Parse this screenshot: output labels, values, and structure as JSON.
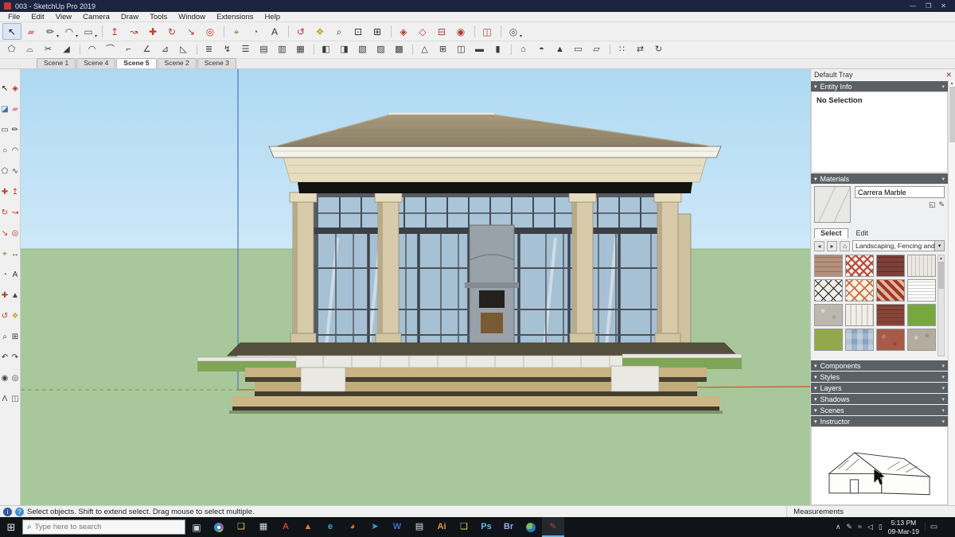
{
  "window": {
    "title": "003 - SketchUp Pro 2019",
    "controls": {
      "minimize": "—",
      "maximize": "❐",
      "close": "✕"
    }
  },
  "menu_bar": {
    "items": [
      {
        "name": "menu-file",
        "label": "File"
      },
      {
        "name": "menu-edit",
        "label": "Edit"
      },
      {
        "name": "menu-view",
        "label": "View"
      },
      {
        "name": "menu-camera",
        "label": "Camera"
      },
      {
        "name": "menu-draw",
        "label": "Draw"
      },
      {
        "name": "menu-tools",
        "label": "Tools"
      },
      {
        "name": "menu-window",
        "label": "Window"
      },
      {
        "name": "menu-extensions",
        "label": "Extensions"
      },
      {
        "name": "menu-help",
        "label": "Help"
      }
    ]
  },
  "toolbar_main": {
    "icons": [
      {
        "name": "select-tool",
        "g": "↖",
        "color": "#111111",
        "active": true
      },
      {
        "name": "eraser-tool",
        "g": "▰",
        "color": "#de8da4"
      },
      {
        "name": "line-tool",
        "g": "✏",
        "color": "#333333",
        "caret": true
      },
      {
        "name": "arc-tool",
        "g": "◠",
        "color": "#7a3636",
        "caret": true
      },
      {
        "name": "rectangle-tool",
        "g": "▭",
        "color": "#555555",
        "caret": true
      },
      {
        "name": "pushpull-tool",
        "g": "↥",
        "color": "#c0392b",
        "sep": true
      },
      {
        "name": "followme-tool",
        "g": "↝",
        "color": "#c0392b"
      },
      {
        "name": "move-tool",
        "g": "✚",
        "color": "#c0392b"
      },
      {
        "name": "rotate-tool",
        "g": "↻",
        "color": "#c0392b"
      },
      {
        "name": "scale-tool",
        "g": "↘",
        "color": "#c0392b"
      },
      {
        "name": "offset-tool",
        "g": "◎",
        "color": "#c0392b"
      },
      {
        "name": "tape-measure-tool",
        "g": "⌖",
        "color": "#8a6d1f",
        "sep": true
      },
      {
        "name": "protractor-tool",
        "g": "◔",
        "color": "#8a6d1f"
      },
      {
        "name": "text-tool",
        "g": "A",
        "color": "#333333"
      },
      {
        "name": "orbit-tool",
        "g": "↺",
        "color": "#b03a2e",
        "sep": true
      },
      {
        "name": "pan-tool",
        "g": "❖",
        "color": "#cf9f35"
      },
      {
        "name": "zoom-tool",
        "g": "⌕",
        "color": "#333333"
      },
      {
        "name": "zoom-window-tool",
        "g": "⊡",
        "color": "#333333"
      },
      {
        "name": "zoom-extents-tool",
        "g": "⊞",
        "color": "#333333"
      },
      {
        "name": "make-component-tool",
        "g": "◈",
        "color": "#b03a2e",
        "sep": true
      },
      {
        "name": "component-options-tool",
        "g": "◇",
        "color": "#b03a2e"
      },
      {
        "name": "dynamic-component-tool",
        "g": "⊟",
        "color": "#b03a2e"
      },
      {
        "name": "interact-tool",
        "g": "◉",
        "color": "#b03a2e"
      },
      {
        "name": "section-plane-tool",
        "g": "◫",
        "color": "#b03a2e",
        "sep": true
      },
      {
        "name": "look-around-tool",
        "g": "◎",
        "color": "#555555",
        "caret": true,
        "sep": true
      }
    ]
  },
  "toolbar_secondary": {
    "icons": [
      {
        "name": "offset-edges-tool",
        "g": "⬠"
      },
      {
        "name": "extrude-profile-tool",
        "g": "⌓"
      },
      {
        "name": "cut-opening-tool",
        "g": "✂"
      },
      {
        "name": "taper-face-tool",
        "g": "◢"
      },
      {
        "name": "arc-wall-tool",
        "g": "◠",
        "sep": true
      },
      {
        "name": "fillet-edge-tool",
        "g": "⌒"
      },
      {
        "name": "corner-trim-tool",
        "g": "⌐"
      },
      {
        "name": "chamfer-tool",
        "g": "∠"
      },
      {
        "name": "slope-face-tool",
        "g": "⊿"
      },
      {
        "name": "ramp-tool",
        "g": "◺"
      },
      {
        "name": "stairs-tool",
        "g": "≣",
        "sep": true
      },
      {
        "name": "spiral-stairs-tool",
        "g": "↯"
      },
      {
        "name": "railing-tool",
        "g": "☰"
      },
      {
        "name": "fence-tool",
        "g": "▤"
      },
      {
        "name": "louver-tool",
        "g": "▥"
      },
      {
        "name": "lattice-tool",
        "g": "▦"
      },
      {
        "name": "shade-left-tool",
        "g": "◧",
        "sep": true
      },
      {
        "name": "shade-right-tool",
        "g": "◨"
      },
      {
        "name": "hatch-one-tool",
        "g": "▧"
      },
      {
        "name": "hatch-two-tool",
        "g": "▨"
      },
      {
        "name": "grille-tool",
        "g": "▩"
      },
      {
        "name": "truss-tool",
        "g": "△",
        "sep": true
      },
      {
        "name": "frame-tool",
        "g": "⊞"
      },
      {
        "name": "panel-tool",
        "g": "◫"
      },
      {
        "name": "beam-tool",
        "g": "▬"
      },
      {
        "name": "column-tool",
        "g": "▮"
      },
      {
        "name": "roof-tool",
        "g": "⌂",
        "sep": true
      },
      {
        "name": "dome-tool",
        "g": "◓"
      },
      {
        "name": "pyramid-tool",
        "g": "▲"
      },
      {
        "name": "wall-tool",
        "g": "▭"
      },
      {
        "name": "floor-tool",
        "g": "▱"
      },
      {
        "name": "array-tool",
        "g": "∷",
        "sep": true
      },
      {
        "name": "mirror-tool",
        "g": "⇄"
      },
      {
        "name": "rotate-array-tool",
        "g": "↻"
      }
    ]
  },
  "scene_tabs": {
    "tabs": [
      {
        "name": "scene-tab-1",
        "label": "Scene 1"
      },
      {
        "name": "scene-tab-4",
        "label": "Scene 4"
      },
      {
        "name": "scene-tab-5",
        "label": "Scene 5",
        "active": true
      },
      {
        "name": "scene-tab-2",
        "label": "Scene 2"
      },
      {
        "name": "scene-tab-3",
        "label": "Scene 3"
      }
    ]
  },
  "left_toolbar": {
    "icons": [
      {
        "name": "select-tool",
        "g": "↖",
        "color": "#111111"
      },
      {
        "name": "make-component-tool",
        "g": "◈",
        "color": "#b03a2e"
      },
      {
        "name": "paint-bucket-tool",
        "g": "◪",
        "color": "#3f6db5"
      },
      {
        "name": "eraser-tool",
        "g": "▰",
        "color": "#de8da4"
      },
      {
        "name": "rectangle-tool",
        "g": "▭",
        "color": "#444444"
      },
      {
        "name": "line-tool",
        "g": "✏",
        "color": "#333333"
      },
      {
        "name": "circle-tool",
        "g": "○",
        "color": "#444444"
      },
      {
        "name": "arc-tool",
        "g": "◠",
        "color": "#444444"
      },
      {
        "name": "polygon-tool",
        "g": "⬠",
        "color": "#444444"
      },
      {
        "name": "freehand-tool",
        "g": "∿",
        "color": "#444444"
      },
      {
        "name": "move-tool",
        "g": "✚",
        "color": "#c0392b"
      },
      {
        "name": "pushpull-tool",
        "g": "↥",
        "color": "#c0392b"
      },
      {
        "name": "rotate-tool",
        "g": "↻",
        "color": "#c0392b"
      },
      {
        "name": "followme-tool",
        "g": "↝",
        "color": "#c0392b"
      },
      {
        "name": "scale-tool",
        "g": "↘",
        "color": "#c0392b"
      },
      {
        "name": "offset-tool",
        "g": "◎",
        "color": "#c0392b"
      },
      {
        "name": "tape-measure-tool",
        "g": "⌖",
        "color": "#8a6d1f"
      },
      {
        "name": "dimension-tool",
        "g": "↔",
        "color": "#333333"
      },
      {
        "name": "protractor-tool",
        "g": "◔",
        "color": "#8a6d1f"
      },
      {
        "name": "text-tool",
        "g": "A",
        "color": "#333333"
      },
      {
        "name": "axes-tool",
        "g": "✚",
        "color": "#b03a2e"
      },
      {
        "name": "threed-text-tool",
        "g": "▲",
        "color": "#444444"
      },
      {
        "name": "orbit-tool",
        "g": "↺",
        "color": "#b03a2e"
      },
      {
        "name": "pan-tool",
        "g": "❖",
        "color": "#cf9f35"
      },
      {
        "name": "zoom-tool",
        "g": "⌕",
        "color": "#333333"
      },
      {
        "name": "zoom-extents-tool",
        "g": "⊞",
        "color": "#333333"
      },
      {
        "name": "previous-view-tool",
        "g": "↶",
        "color": "#333333"
      },
      {
        "name": "next-view-tool",
        "g": "↷",
        "color": "#333333"
      },
      {
        "name": "position-camera-tool",
        "g": "◉",
        "color": "#444444"
      },
      {
        "name": "look-around-tool",
        "g": "◎",
        "color": "#444444"
      },
      {
        "name": "walk-tool",
        "g": "Λ",
        "color": "#444444"
      },
      {
        "name": "section-plane-tool",
        "g": "◫",
        "color": "#2e7d32"
      }
    ]
  },
  "viewport": {
    "sky_color": "#b2dcf4",
    "ground_color": "#a8c89c",
    "axis_blue": "#4f74cc",
    "axis_green": "#6f9e3f",
    "axis_red": "#d4552a"
  },
  "tray": {
    "title": "Default Tray",
    "close_glyph": "✕",
    "scroll_up_glyph": "▴",
    "scroll_down_glyph": "▾",
    "entity_info": {
      "label": "Entity Info",
      "arrow": "▾",
      "end": "▾",
      "content": "No Selection"
    },
    "materials": {
      "label": "Materials",
      "arrow": "▾",
      "end": "▾",
      "name_value": "Carrera Marble",
      "secondary_pane_glyph": "◱",
      "sample_glyph": "✎",
      "tabs": [
        {
          "name": "materials-tab-select",
          "label": "Select",
          "active": true
        },
        {
          "name": "materials-tab-edit",
          "label": "Edit"
        }
      ],
      "back_glyph": "◂",
      "forward_glyph": "▸",
      "home_glyph": "⌂",
      "dropdown_value": "Landscaping, Fencing and Ve",
      "dropdown_caret": "▾",
      "swatches": [
        {
          "name": "swatch-brick-tan",
          "bg": "repeating-linear-gradient(0deg, #b5917c 0 5px, #8f6f5c 5px 6px)"
        },
        {
          "name": "swatch-trellis-red",
          "bg": "repeating-linear-gradient(45deg, rgba(0,0,0,0) 0 5px, #b8453a 5px 7px), repeating-linear-gradient(-45deg, rgba(0,0,0,0) 0 5px, #b8453a 5px 7px), #f5f0ea"
        },
        {
          "name": "swatch-brick-burgundy",
          "bg": "repeating-linear-gradient(0deg, #7d4038 0 5px, #5e2c26 5px 6px)"
        },
        {
          "name": "swatch-siding-white",
          "bg": "repeating-linear-gradient(90deg, #ece9e2 0 4px, #c9c5ba 4px 5px)"
        },
        {
          "name": "swatch-tile-diamond-black",
          "bg": "repeating-linear-gradient(45deg, #222 0 1px, rgba(0,0,0,0) 1px 9px), repeating-linear-gradient(-45deg, #222 0 1px, rgba(0,0,0,0) 1px 9px), #f2f0ea"
        },
        {
          "name": "swatch-tile-diamond-orange",
          "bg": "repeating-linear-gradient(45deg, #d2622a 0 1.5px, rgba(0,0,0,0) 1.5px 9px), repeating-linear-gradient(-45deg, #d2622a 0 1.5px, rgba(0,0,0,0) 1.5px 9px), #f6f1e8"
        },
        {
          "name": "swatch-weave-terracotta",
          "bg": "repeating-linear-gradient(45deg, #a93226 0 4px, #d9b9a0 4px 8px)"
        },
        {
          "name": "swatch-lattice-white",
          "bg": "repeating-linear-gradient(0deg, #fff 0 3px, #cfcdc6 3px 4px), repeating-linear-gradient(90deg, #fff 0 3px, #cfcdc6 3px 4px), #ffffff"
        },
        {
          "name": "swatch-pebbles-gray",
          "bg": "radial-gradient(circle at 30% 30%, #d8d4cb 2px, rgba(0,0,0,0) 3px), radial-gradient(circle at 70% 60%, #a8a49a 2px, rgba(0,0,0,0) 3px), #bcb8ae"
        },
        {
          "name": "swatch-fence-white",
          "bg": "repeating-linear-gradient(90deg, #f2efe8 0 5px, #d5d1c6 5px 7px)"
        },
        {
          "name": "swatch-brick-red",
          "bg": "repeating-linear-gradient(0deg, #8a4438 0 4px, #6e332a 4px 5px)"
        },
        {
          "name": "swatch-grass-green",
          "bg": "#76a83e"
        },
        {
          "name": "swatch-grass-olive",
          "bg": "#93a84c"
        },
        {
          "name": "swatch-tile-blue-check",
          "bg": "repeating-linear-gradient(90deg, rgba(255,255,255,0.35) 0 7px, rgba(0,0,0,0) 7px 14px), repeating-linear-gradient(0deg, #9fb6cc 0 7px, #8aa3bc 7px 14px)"
        },
        {
          "name": "swatch-gravel-red",
          "bg": "radial-gradient(circle at 25% 35%, #c07a66 2px, rgba(0,0,0,0) 3px), radial-gradient(circle at 65% 70%, #8e4a3a 2px, rgba(0,0,0,0) 3px), #a65a48"
        },
        {
          "name": "swatch-gravel-gray",
          "bg": "radial-gradient(circle at 30% 40%, #cfc9bd 2px, rgba(0,0,0,0) 3px), radial-gradient(circle at 70% 30%, #9a948a 2px, rgba(0,0,0,0) 3px), #b3ac9f"
        }
      ]
    },
    "collapsed_panels": [
      {
        "name": "panel-components",
        "label": "Components",
        "arrow": "▾",
        "end": "▾"
      },
      {
        "name": "panel-styles",
        "label": "Styles",
        "arrow": "▾",
        "end": "▾"
      },
      {
        "name": "panel-layers",
        "label": "Layers",
        "arrow": "▾",
        "end": "▾"
      },
      {
        "name": "panel-shadows",
        "label": "Shadows",
        "arrow": "▾",
        "end": "▾"
      },
      {
        "name": "panel-scenes",
        "label": "Scenes",
        "arrow": "▾",
        "end": "▾"
      }
    ],
    "instructor": {
      "label": "Instructor",
      "arrow": "▾",
      "end": "▾"
    }
  },
  "status_bar": {
    "info_glyph": "i",
    "help_glyph": "?",
    "message": "Select objects. Shift to extend select. Drag mouse to select multiple.",
    "measurements_label": "Measurements"
  },
  "taskbar": {
    "start_glyph": "⊞",
    "search": {
      "icon_glyph": "⌕",
      "placeholder": "Type here to search"
    },
    "task_view_glyph": "▣",
    "apps": [
      {
        "name": "chrome-icon",
        "g": "",
        "gbg": "radial-gradient(circle at 50% 50%, #ffffff 0 2px, #4285f4 2px 4.5px, rgba(0,0,0,0) 4.5px), conic-gradient(#ea4335 0deg 120deg, #fbbc05 120deg 180deg, #34a853 180deg 300deg, #4285f4 300deg 360deg)"
      },
      {
        "name": "file-explorer-icon",
        "g": "❏",
        "color": "#f0c24b"
      },
      {
        "name": "calculator-icon",
        "g": "▦",
        "color": "#d4dae0"
      },
      {
        "name": "acrobat-icon",
        "g": "A",
        "color": "#e2372c"
      },
      {
        "name": "media-player-icon",
        "g": "▲",
        "color": "#d87f2a"
      },
      {
        "name": "edge-icon",
        "g": "e",
        "color": "#3f9fe0"
      },
      {
        "name": "firefox-icon",
        "g": "◕",
        "color": "#e8762c"
      },
      {
        "name": "telegram-icon",
        "g": "➤",
        "color": "#35a6dc"
      },
      {
        "name": "word-icon",
        "g": "W",
        "color": "#3a6fc4"
      },
      {
        "name": "notepad-icon",
        "g": "▤",
        "color": "#dfe3e8"
      },
      {
        "name": "illustrator-icon",
        "g": "Ai",
        "color": "#e8952c"
      },
      {
        "name": "folder-icon",
        "g": "❏",
        "color": "#e8c84b"
      },
      {
        "name": "photoshop-icon",
        "g": "Ps",
        "color": "#6bb3e8"
      },
      {
        "name": "bridge-icon",
        "g": "Br",
        "color": "#8fa8e8"
      },
      {
        "name": "earth-icon",
        "g": "",
        "gbg": "radial-gradient(circle at 35% 35%, #7ec14f 0 4px, #2f76c4 4px 7px)"
      },
      {
        "name": "sketchup-icon",
        "g": "✎",
        "color": "#d4372c",
        "active": true
      }
    ],
    "tray_glyphs": [
      {
        "name": "hidden-icons-chevron",
        "g": "∧"
      },
      {
        "name": "pen-tray-icon",
        "g": "✎"
      },
      {
        "name": "network-tray-icon",
        "g": "≈"
      },
      {
        "name": "volume-tray-icon",
        "g": "◁"
      },
      {
        "name": "battery-tray-icon",
        "g": "▯"
      }
    ],
    "clock": {
      "time": "5:13 PM",
      "date": "09-Mar-19"
    },
    "notification_glyph": "▭"
  }
}
